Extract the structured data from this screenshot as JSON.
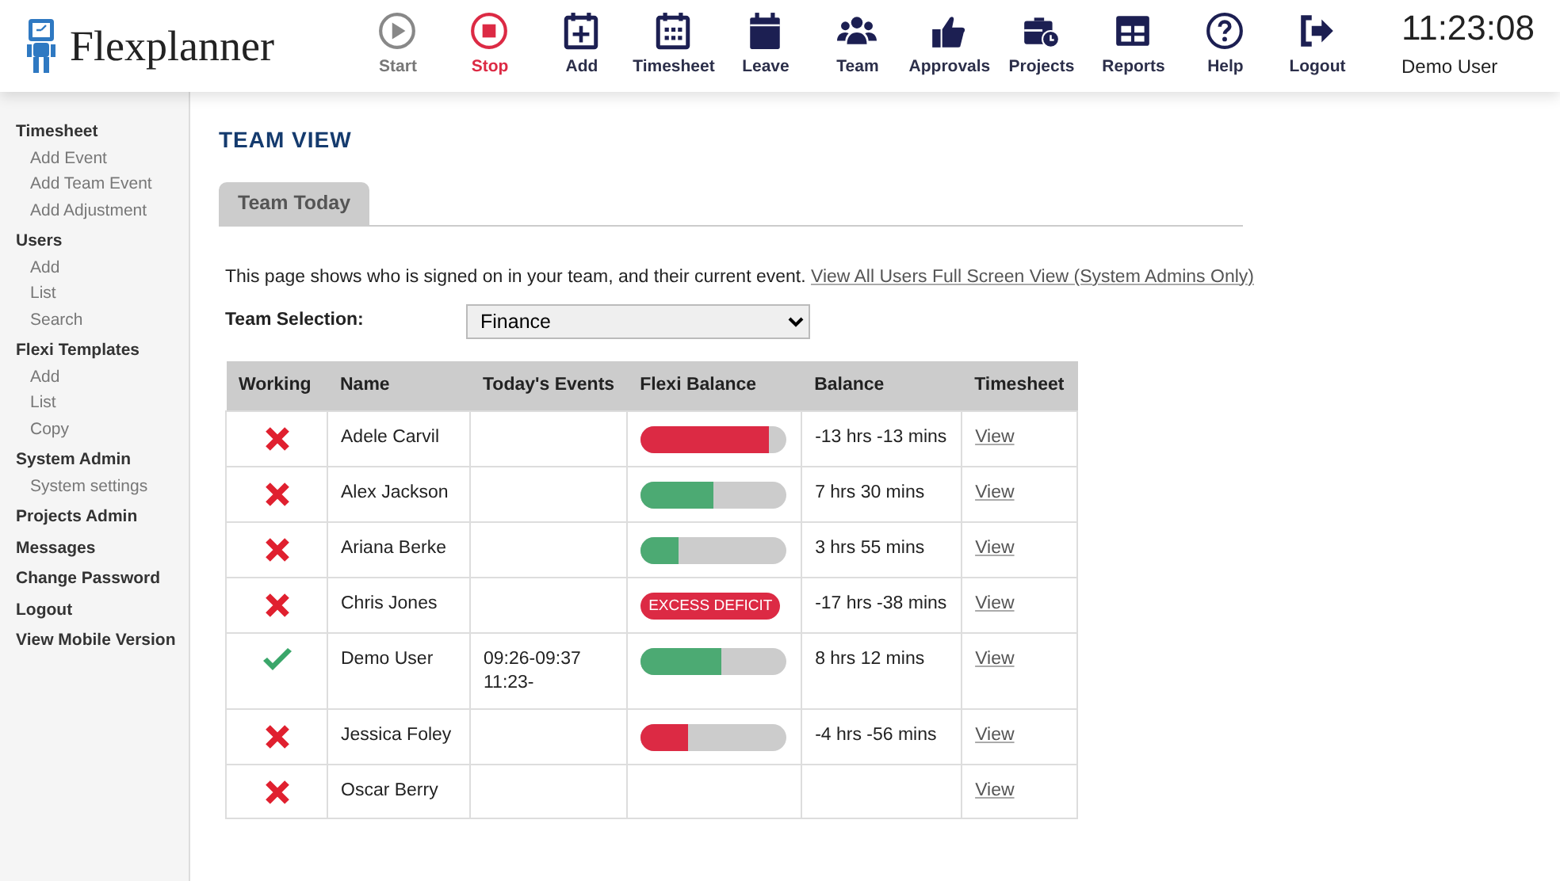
{
  "app": {
    "name": "Flexplanner"
  },
  "toolbar": [
    {
      "kind": "start",
      "label": "Start",
      "disabled": true,
      "active": false
    },
    {
      "kind": "stop",
      "label": "Stop",
      "disabled": false,
      "active": true
    },
    {
      "kind": "add",
      "label": "Add",
      "disabled": false,
      "active": false
    },
    {
      "kind": "timesheet",
      "label": "Timesheet",
      "disabled": false,
      "active": false
    },
    {
      "kind": "leave",
      "label": "Leave",
      "disabled": false,
      "active": false
    },
    {
      "kind": "team",
      "label": "Team",
      "disabled": false,
      "active": false
    },
    {
      "kind": "approvals",
      "label": "Approvals",
      "disabled": false,
      "active": false
    },
    {
      "kind": "projects",
      "label": "Projects",
      "disabled": false,
      "active": false
    },
    {
      "kind": "reports",
      "label": "Reports",
      "disabled": false,
      "active": false
    },
    {
      "kind": "help",
      "label": "Help",
      "disabled": false,
      "active": false
    },
    {
      "kind": "logout",
      "label": "Logout",
      "disabled": false,
      "active": false
    }
  ],
  "clock": {
    "time": "11:23:08",
    "user": "Demo User"
  },
  "sidebar": {
    "items": [
      {
        "label": "Timesheet",
        "children": [
          {
            "label": "Add Event"
          },
          {
            "label": "Add Team Event"
          },
          {
            "label": "Add Adjustment"
          }
        ]
      },
      {
        "label": "Users",
        "children": [
          {
            "label": "Add"
          },
          {
            "label": "List"
          },
          {
            "label": "Search"
          }
        ]
      },
      {
        "label": "Flexi Templates",
        "children": [
          {
            "label": "Add"
          },
          {
            "label": "List"
          },
          {
            "label": "Copy"
          }
        ]
      },
      {
        "label": "System Admin",
        "children": [
          {
            "label": "System settings"
          }
        ]
      },
      {
        "label": "Projects Admin"
      },
      {
        "label": "Messages"
      },
      {
        "label": "Change Password"
      },
      {
        "label": "Logout"
      },
      {
        "label": "View Mobile Version"
      }
    ]
  },
  "page": {
    "title": "TEAM VIEW",
    "tabs": [
      {
        "label": "Team Today",
        "selected": true
      }
    ],
    "intro": "This page shows who is signed on in your team, and their current event.",
    "intro_link": "View All Users Full Screen View (System Admins Only)",
    "team_selection": {
      "label": "Team Selection:",
      "value": "Finance"
    }
  },
  "table": {
    "columns": [
      "Working",
      "Name",
      "Today's Events",
      "Flexi Balance",
      "Balance",
      "Timesheet"
    ],
    "rows": [
      {
        "working": false,
        "name": "Adele Carvil",
        "events": [],
        "flexi": {
          "kind": "bar",
          "level": 0.88,
          "color": "#dc2a44"
        },
        "balance": "-13 hrs -13 mins",
        "link": "View"
      },
      {
        "working": false,
        "name": "Alex Jackson",
        "events": [],
        "flexi": {
          "kind": "bar",
          "level": 0.5,
          "color": "#4caa73"
        },
        "balance": "7 hrs 30 mins",
        "link": "View"
      },
      {
        "working": false,
        "name": "Ariana Berke",
        "events": [],
        "flexi": {
          "kind": "bar",
          "level": 0.26,
          "color": "#4caa73"
        },
        "balance": "3 hrs 55 mins",
        "link": "View"
      },
      {
        "working": false,
        "name": "Chris Jones",
        "events": [],
        "flexi": {
          "kind": "badge",
          "text": "EXCESS DEFICIT"
        },
        "balance": "-17 hrs -38 mins",
        "link": "View"
      },
      {
        "working": true,
        "name": "Demo User",
        "events": [
          "09:26-09:37",
          "11:23-"
        ],
        "flexi": {
          "kind": "bar",
          "level": 0.55,
          "color": "#4caa73"
        },
        "balance": "8 hrs 12 mins",
        "link": "View"
      },
      {
        "working": false,
        "name": "Jessica Foley",
        "events": [],
        "flexi": {
          "kind": "bar",
          "level": 0.33,
          "color": "#dc2a44"
        },
        "balance": "-4 hrs -56 mins",
        "link": "View"
      },
      {
        "working": false,
        "name": "Oscar Berry",
        "events": [],
        "link": "View"
      }
    ]
  }
}
